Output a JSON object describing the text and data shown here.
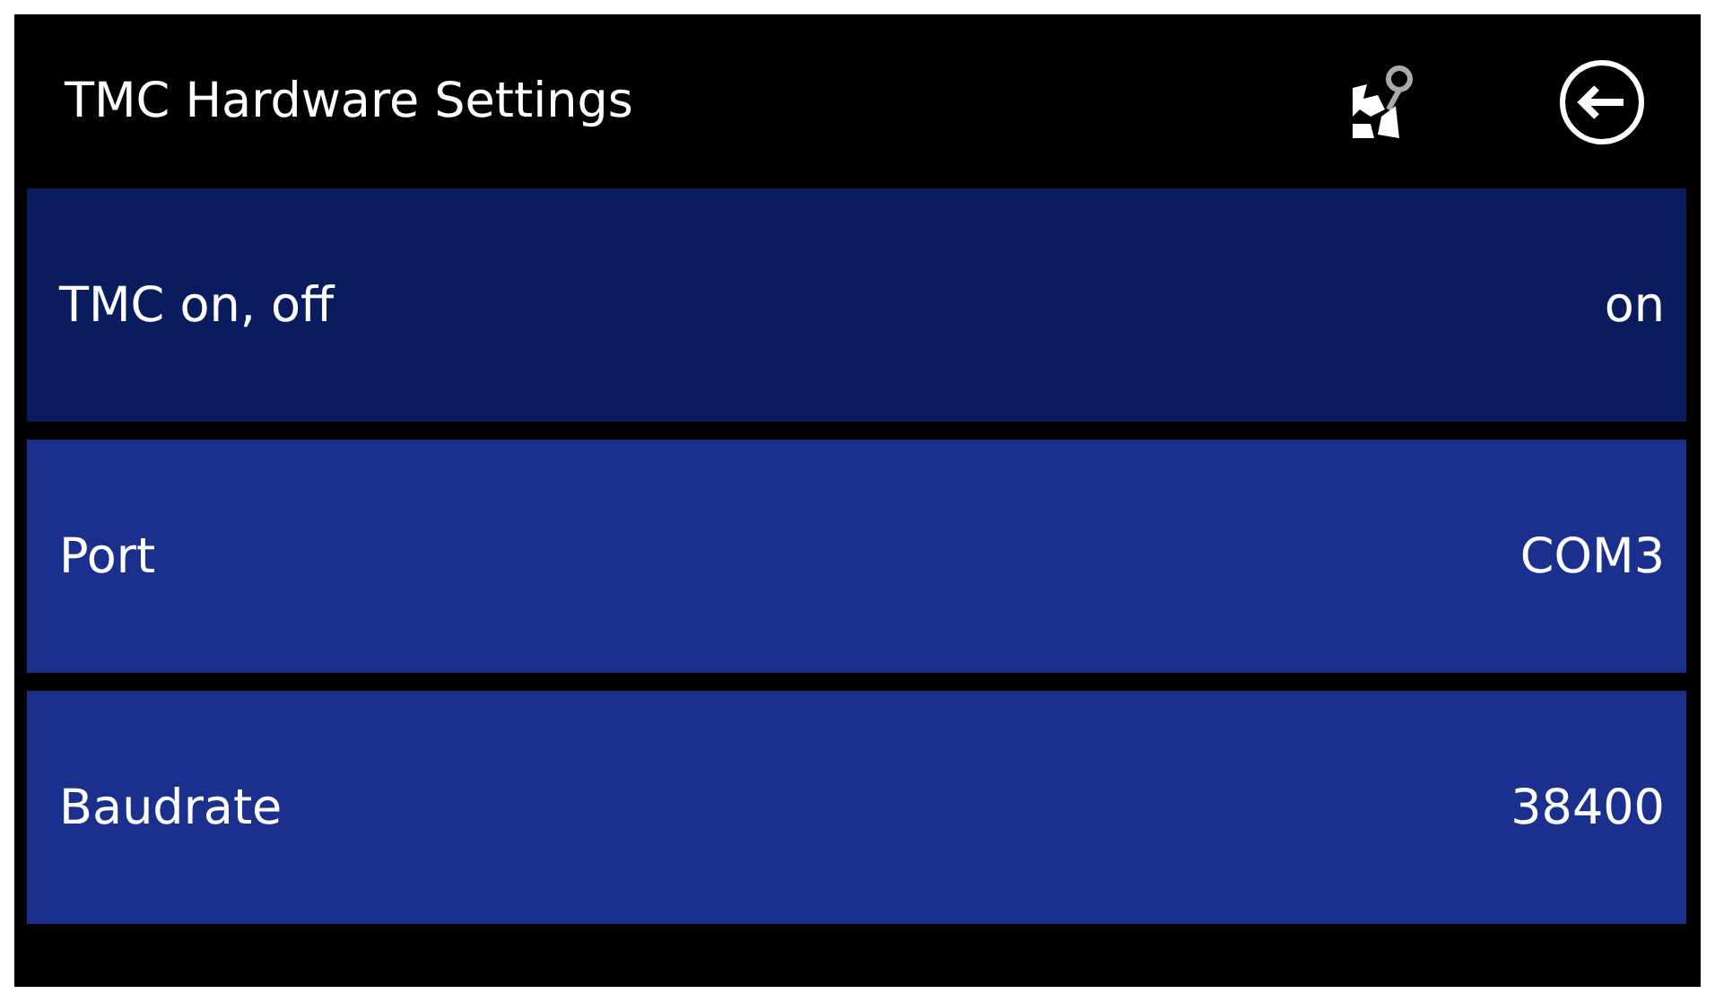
{
  "window": {
    "title": "TMC Hardware Settings"
  },
  "rows": [
    {
      "label": "TMC on, off",
      "value": "on",
      "selected": true
    },
    {
      "label": "Port",
      "value": "COM3",
      "selected": false
    },
    {
      "label": "Baudrate",
      "value": "38400",
      "selected": false
    }
  ]
}
